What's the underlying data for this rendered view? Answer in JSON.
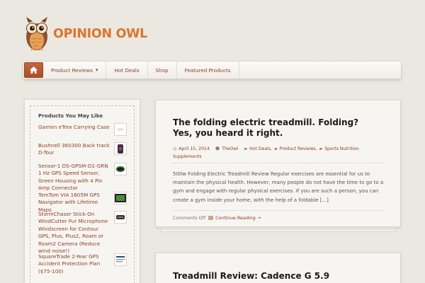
{
  "site": {
    "name": "OPINION OWL"
  },
  "nav": {
    "items": [
      {
        "label": "Product Reviews",
        "has_dropdown": true
      },
      {
        "label": "Hot Deals"
      },
      {
        "label": "Shop"
      },
      {
        "label": "Featured Products"
      }
    ]
  },
  "sidebar": {
    "title": "Products You May Like",
    "products": [
      "Garmin eTrex Carrying Case",
      "Bushnell 360300 Back track D-Tour",
      "Sensor-1 DS-GPSM-D1-GRN 1 Hz GPS Speed Sensor, Green Housing with 4 Pin Amp Connector",
      "TomTom VIA 1605M GPS Navigator with Lifetime Maps",
      "StormChaser Stick-On WindCutter Fur Microphone Windscreen for Contour GPS, Plus, Plus2, Roam or Roam2 Camera (Reduce wind noise!)",
      "SquareTrade 2-Year GPS Accident Protection Plan"
    ],
    "product_tail": "($75-100)"
  },
  "posts": [
    {
      "title_line1": "The folding electric treadmill. Folding?",
      "title_line2": "Yes, you heard it right.",
      "date": "April 15, 2014",
      "author": "TheOwl",
      "cat1": "Hot Deals,",
      "cat2": "Product Reviews,",
      "cat3": "Sports Nutrition",
      "cat4": "Supplements",
      "excerpt": "500w Folding Electric Treadmill Review Regular exercises are essential for us to maintain the physical health. However, many people do not have the time to go to a gym and engage with regular physical exercises. If you are such a person, you can create a gym inside your home, with the help of a foldable [...]",
      "comments": "Comments Off",
      "continue": "Continue Reading →"
    },
    {
      "title_line1": "Treadmill Review: Cadence G 5.9"
    }
  ],
  "colors": {
    "accent": "#8c3f24",
    "logo": "#d9762a",
    "background": "#ebe7e1"
  }
}
